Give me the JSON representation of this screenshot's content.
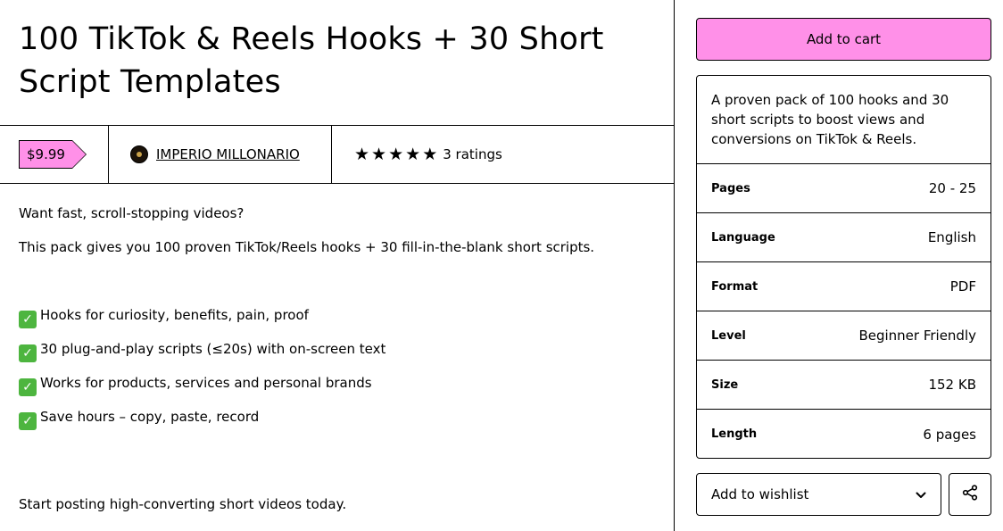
{
  "product": {
    "title": "100 TikTok & Reels Hooks + 30 Short Script Templates",
    "price": "$9.99",
    "seller": "IMPERIO MILLONARIO",
    "rating_stars": 5,
    "ratings_label": "3 ratings"
  },
  "description": {
    "intro": "Want fast, scroll-stopping videos?",
    "body": "This pack gives you 100 proven TikTok/Reels hooks + 30 fill-in-the-blank short scripts.",
    "bullets": [
      "Hooks for curiosity, benefits, pain, proof",
      "30 plug-and-play scripts (≤20s) with on-screen text",
      "Works for products, services and personal brands",
      "Save hours – copy, paste, record"
    ],
    "outro": "Start posting high-converting short videos today."
  },
  "sidebar": {
    "add_to_cart": "Add to cart",
    "summary": "A proven pack of 100 hooks and 30 short scripts to boost views and conversions on TikTok & Reels.",
    "attributes": [
      {
        "label": "Pages",
        "value": "20 - 25"
      },
      {
        "label": "Language",
        "value": "English"
      },
      {
        "label": "Format",
        "value": "PDF"
      },
      {
        "label": "Level",
        "value": "Beginner Friendly"
      },
      {
        "label": "Size",
        "value": "152 KB"
      },
      {
        "label": "Length",
        "value": "6 pages"
      }
    ],
    "wishlist": "Add to wishlist"
  },
  "colors": {
    "accent": "#ff90e8",
    "check": "#4db53f"
  },
  "icons": {
    "star": "star-icon",
    "check": "checkmark-icon",
    "chevron": "chevron-down-icon",
    "share": "share-icon"
  }
}
